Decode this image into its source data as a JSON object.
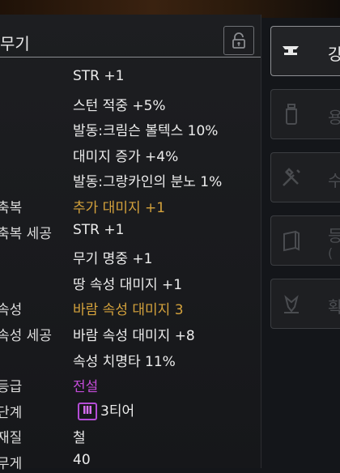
{
  "window": {
    "title": "무기"
  },
  "stats": [
    {
      "label": "",
      "value": "STR +1",
      "color": "white"
    },
    {
      "label": "",
      "value": "스턴 적중 +5%",
      "color": "white"
    },
    {
      "label": "",
      "value": "발동:크림슨 볼텍스 10%",
      "color": "white"
    },
    {
      "label": "",
      "value": "대미지 증가 +4%",
      "color": "white"
    },
    {
      "label": "",
      "value": "발동:그랑카인의 분노 1%",
      "color": "white"
    },
    {
      "label": "축복",
      "value": "추가 대미지 +1",
      "color": "gold"
    },
    {
      "label": "축복 세공",
      "value": "STR +1",
      "color": "white"
    },
    {
      "label": "",
      "value": "무기 명중 +1",
      "color": "white"
    },
    {
      "label": "",
      "value": "땅 속성 대미지 +1",
      "color": "white"
    },
    {
      "label": "속성",
      "value": "바람 속성 대미지  3",
      "color": "gold"
    },
    {
      "label": "속성 세공",
      "value": "바람 속성 대미지 +8",
      "color": "white"
    },
    {
      "label": "",
      "value": "속성 치명타 11%",
      "color": "white"
    },
    {
      "label": "등급",
      "value": "전설",
      "color": "purple"
    },
    {
      "label": "단계",
      "value": "3티어",
      "color": "white",
      "badge": "Ⅲ"
    },
    {
      "label": "재질",
      "value": "철",
      "color": "white"
    },
    {
      "label": "무게",
      "value": "40",
      "color": "white"
    }
  ],
  "side_buttons": [
    {
      "icon": "anvil-icon",
      "label": "강",
      "sub": "",
      "active": true
    },
    {
      "icon": "potion-bottle-icon",
      "label": "용",
      "sub": "",
      "active": false
    },
    {
      "icon": "tools-icon",
      "label": "수",
      "sub": "",
      "active": false
    },
    {
      "icon": "book-icon",
      "label": "등",
      "sub": "(",
      "active": false
    },
    {
      "icon": "emblem-icon",
      "label": "확",
      "sub": "",
      "active": false
    }
  ],
  "colors": {
    "white": "#ececec",
    "gold": "#d4a23c",
    "purple": "#c34bd8",
    "active_text": "#e8e8e8",
    "inactive_text": "#4a4c50"
  }
}
